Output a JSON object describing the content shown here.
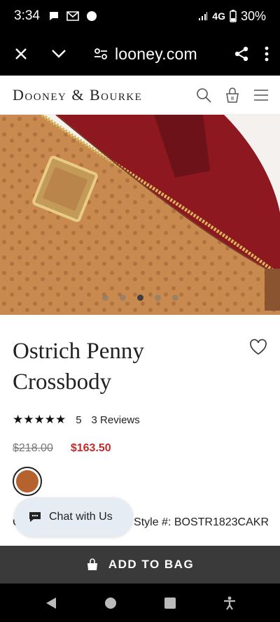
{
  "status": {
    "time": "3:34",
    "network": "4G",
    "battery": "30%"
  },
  "browser": {
    "url": "looney.com"
  },
  "site": {
    "logo": "Dooney & Bourke"
  },
  "hero": {
    "image_count": 5,
    "active_index": 2
  },
  "product": {
    "title": "Ostrich Penny Crossbody",
    "rating": "5",
    "rating_stars": 5,
    "reviews": "3 Reviews",
    "old_price": "$218.00",
    "new_price": "$163.50",
    "swatch_color": "#b5622e",
    "color_label_stub": "C",
    "style": "Style #: BOSTR1823CAKR"
  },
  "chat": {
    "label": "Chat with Us"
  },
  "cta": {
    "add_to_bag": "ADD TO BAG"
  },
  "colors": {
    "accent_price": "#c12b2b",
    "button_bg": "#3a3a3a"
  }
}
